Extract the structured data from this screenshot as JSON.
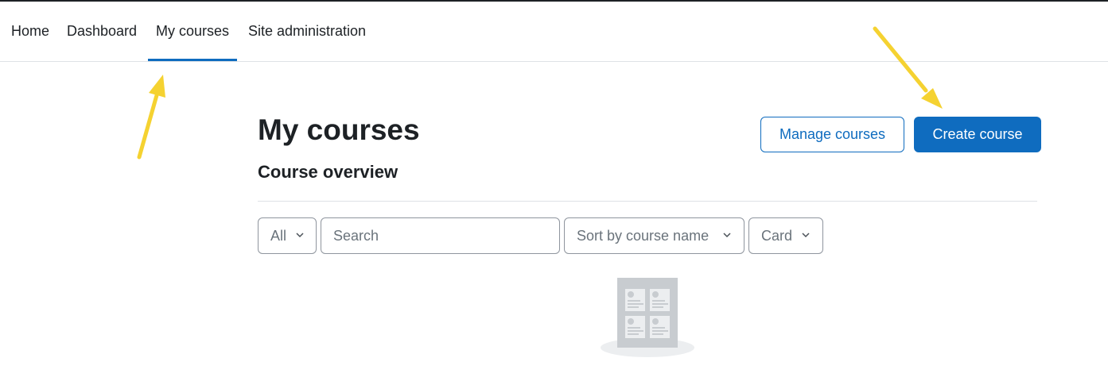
{
  "nav": {
    "items": [
      {
        "label": "Home"
      },
      {
        "label": "Dashboard"
      },
      {
        "label": "My courses",
        "active": true
      },
      {
        "label": "Site administration"
      }
    ]
  },
  "page": {
    "title": "My courses",
    "manage_label": "Manage courses",
    "create_label": "Create course"
  },
  "overview": {
    "title": "Course overview",
    "filter_label": "All",
    "search_placeholder": "Search",
    "sort_label": "Sort by course name",
    "view_label": "Card"
  },
  "colors": {
    "accent": "#0f6cbf",
    "annotation_arrow": "#f5d231",
    "text": "#1d2125",
    "muted": "#6a737b"
  },
  "icons": [
    "chevron-down-icon",
    "empty-courses-illustration",
    "annotation-arrow"
  ]
}
